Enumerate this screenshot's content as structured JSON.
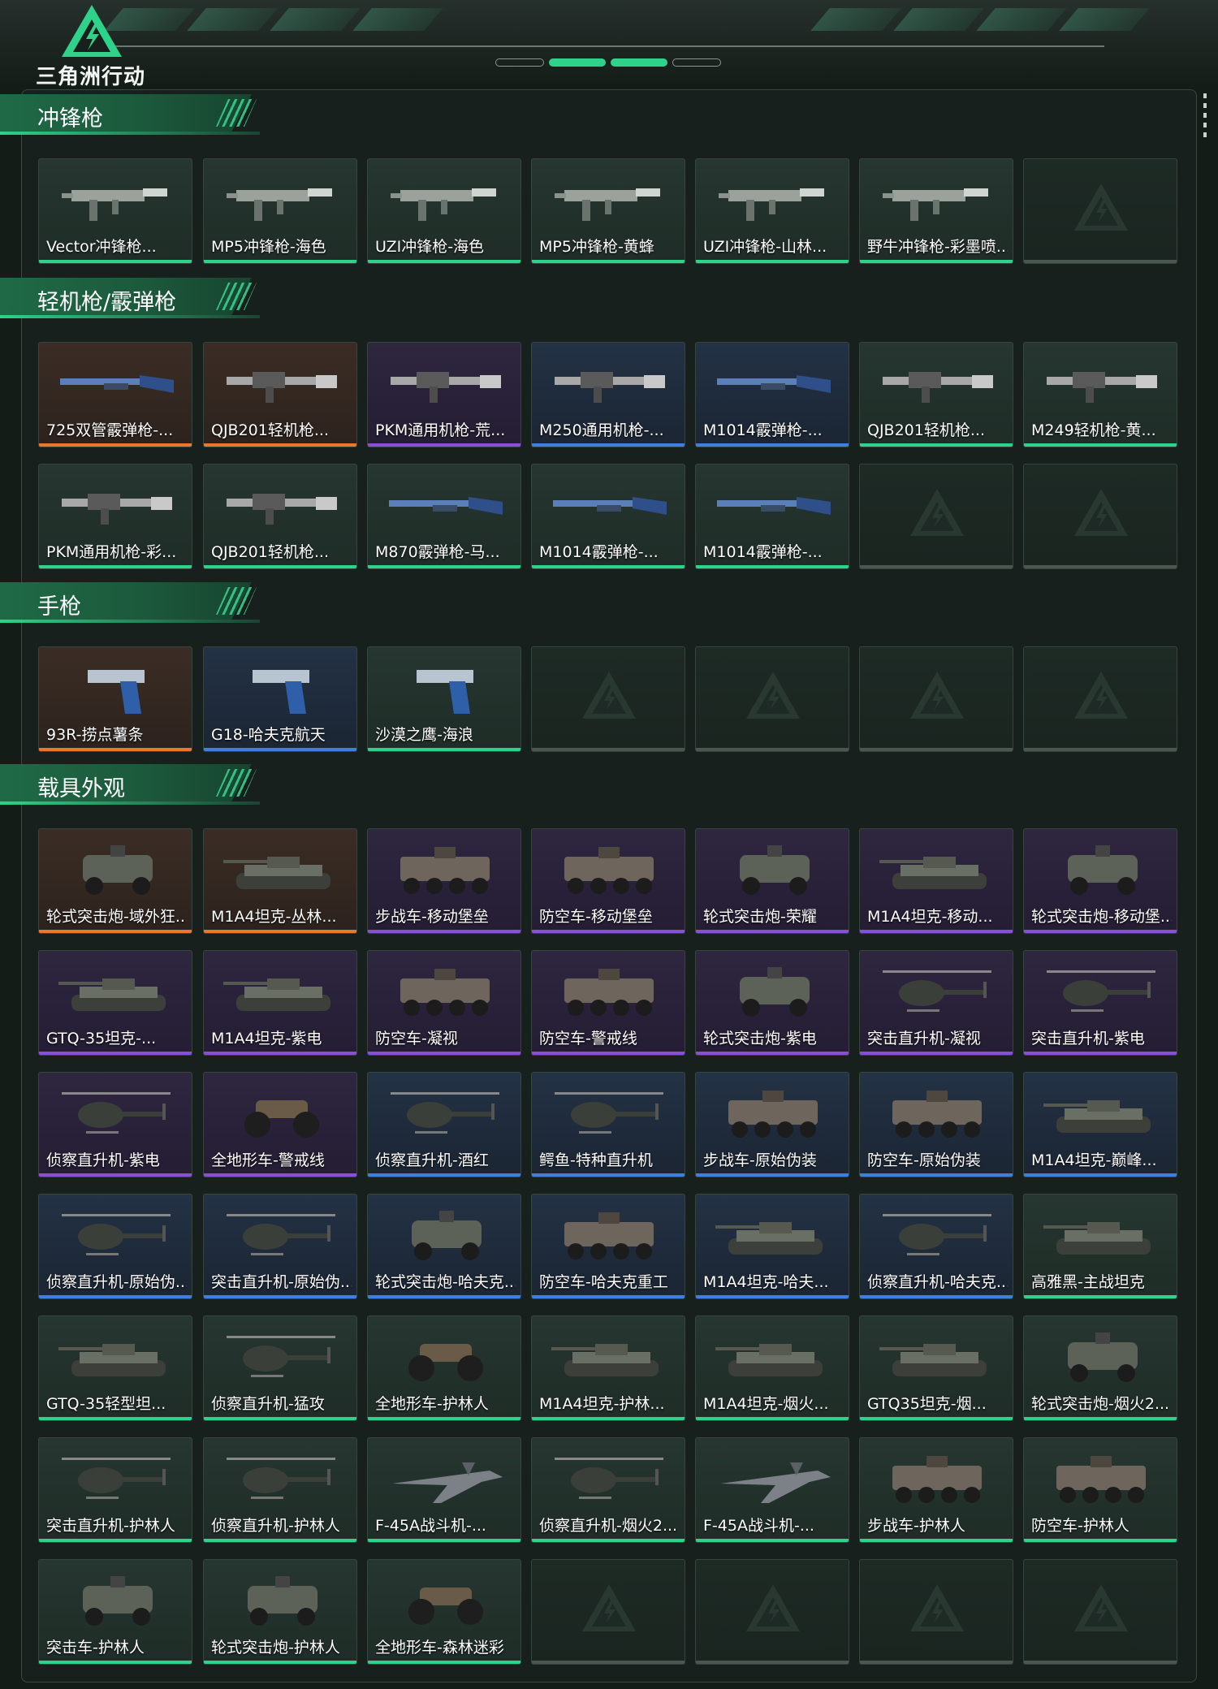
{
  "header": {
    "logo_text": "三角洲行动",
    "colors": {
      "accent": "#2fd28a",
      "panel_border": "#3a4943"
    }
  },
  "rarity_colors": {
    "green": "#2fd28a",
    "blue": "#3f7fe0",
    "purple": "#8a4fd8",
    "orange": "#e6792e",
    "empty": "#4a5650"
  },
  "sections": [
    {
      "title": "冲锋枪",
      "items": [
        {
          "label": "Vector冲锋枪...",
          "rarity": "green",
          "icon": "smg-icon"
        },
        {
          "label": "MP5冲锋枪-海色",
          "rarity": "green",
          "icon": "smg-icon"
        },
        {
          "label": "UZI冲锋枪-海色",
          "rarity": "green",
          "icon": "smg-icon"
        },
        {
          "label": "MP5冲锋枪-黄蜂",
          "rarity": "green",
          "icon": "smg-icon"
        },
        {
          "label": "UZI冲锋枪-山林...",
          "rarity": "green",
          "icon": "smg-icon"
        },
        {
          "label": "野牛冲锋枪-彩墨喷...",
          "rarity": "green",
          "icon": "smg-icon"
        },
        {
          "label": "",
          "rarity": "empty",
          "icon": "placeholder-icon"
        }
      ]
    },
    {
      "title": "轻机枪/霰弹枪",
      "items": [
        {
          "label": "725双管霰弹枪-...",
          "rarity": "orange",
          "icon": "shotgun-icon"
        },
        {
          "label": "QJB201轻机枪...",
          "rarity": "orange",
          "icon": "lmg-icon"
        },
        {
          "label": "PKM通用机枪-荒...",
          "rarity": "purple",
          "icon": "lmg-icon"
        },
        {
          "label": "M250通用机枪-...",
          "rarity": "blue",
          "icon": "lmg-icon"
        },
        {
          "label": "M1014霰弹枪-...",
          "rarity": "blue",
          "icon": "shotgun-icon"
        },
        {
          "label": "QJB201轻机枪...",
          "rarity": "green",
          "icon": "lmg-icon"
        },
        {
          "label": "M249轻机枪-黄...",
          "rarity": "green",
          "icon": "lmg-icon"
        },
        {
          "label": "PKM通用机枪-彩...",
          "rarity": "green",
          "icon": "lmg-icon"
        },
        {
          "label": "QJB201轻机枪...",
          "rarity": "green",
          "icon": "lmg-icon"
        },
        {
          "label": "M870霰弹枪-马...",
          "rarity": "green",
          "icon": "shotgun-icon"
        },
        {
          "label": "M1014霰弹枪-...",
          "rarity": "green",
          "icon": "shotgun-icon"
        },
        {
          "label": "M1014霰弹枪-...",
          "rarity": "green",
          "icon": "shotgun-icon"
        },
        {
          "label": "",
          "rarity": "empty",
          "icon": "placeholder-icon"
        },
        {
          "label": "",
          "rarity": "empty",
          "icon": "placeholder-icon"
        }
      ]
    },
    {
      "title": "手枪",
      "items": [
        {
          "label": "93R-捞点薯条",
          "rarity": "orange",
          "icon": "pistol-icon"
        },
        {
          "label": "G18-哈夫克航天",
          "rarity": "blue",
          "icon": "pistol-icon"
        },
        {
          "label": "沙漠之鹰-海浪",
          "rarity": "green",
          "icon": "pistol-icon"
        },
        {
          "label": "",
          "rarity": "empty",
          "icon": "placeholder-icon"
        },
        {
          "label": "",
          "rarity": "empty",
          "icon": "placeholder-icon"
        },
        {
          "label": "",
          "rarity": "empty",
          "icon": "placeholder-icon"
        },
        {
          "label": "",
          "rarity": "empty",
          "icon": "placeholder-icon"
        }
      ]
    },
    {
      "title": "载具外观",
      "items": [
        {
          "label": "轮式突击炮-域外狂...",
          "rarity": "orange",
          "icon": "armored-car-icon"
        },
        {
          "label": "M1A4坦克-丛林...",
          "rarity": "orange",
          "icon": "tank-icon"
        },
        {
          "label": "步战车-移动堡垒",
          "rarity": "purple",
          "icon": "apc-icon"
        },
        {
          "label": "防空车-移动堡垒",
          "rarity": "purple",
          "icon": "apc-icon"
        },
        {
          "label": "轮式突击炮-荣耀",
          "rarity": "purple",
          "icon": "armored-car-icon"
        },
        {
          "label": "M1A4坦克-移动...",
          "rarity": "purple",
          "icon": "tank-icon"
        },
        {
          "label": "轮式突击炮-移动堡...",
          "rarity": "purple",
          "icon": "armored-car-icon"
        },
        {
          "label": "GTQ-35坦克-...",
          "rarity": "purple",
          "icon": "tank-icon"
        },
        {
          "label": "M1A4坦克-紫电",
          "rarity": "purple",
          "icon": "tank-icon"
        },
        {
          "label": "防空车-凝视",
          "rarity": "purple",
          "icon": "apc-icon"
        },
        {
          "label": "防空车-警戒线",
          "rarity": "purple",
          "icon": "apc-icon"
        },
        {
          "label": "轮式突击炮-紫电",
          "rarity": "purple",
          "icon": "armored-car-icon"
        },
        {
          "label": "突击直升机-凝视",
          "rarity": "purple",
          "icon": "helicopter-icon"
        },
        {
          "label": "突击直升机-紫电",
          "rarity": "purple",
          "icon": "helicopter-icon"
        },
        {
          "label": "侦察直升机-紫电",
          "rarity": "purple",
          "icon": "helicopter-icon"
        },
        {
          "label": "全地形车-警戒线",
          "rarity": "purple",
          "icon": "atv-icon"
        },
        {
          "label": "侦察直升机-酒红",
          "rarity": "blue",
          "icon": "helicopter-icon"
        },
        {
          "label": "鳄鱼-特种直升机",
          "rarity": "blue",
          "icon": "helicopter-icon"
        },
        {
          "label": "步战车-原始伪装",
          "rarity": "blue",
          "icon": "apc-icon"
        },
        {
          "label": "防空车-原始伪装",
          "rarity": "blue",
          "icon": "apc-icon"
        },
        {
          "label": "M1A4坦克-巅峰...",
          "rarity": "blue",
          "icon": "tank-icon"
        },
        {
          "label": "侦察直升机-原始伪...",
          "rarity": "blue",
          "icon": "helicopter-icon"
        },
        {
          "label": "突击直升机-原始伪...",
          "rarity": "blue",
          "icon": "helicopter-icon"
        },
        {
          "label": "轮式突击炮-哈夫克...",
          "rarity": "blue",
          "icon": "armored-car-icon"
        },
        {
          "label": "防空车-哈夫克重工",
          "rarity": "blue",
          "icon": "apc-icon"
        },
        {
          "label": "M1A4坦克-哈夫...",
          "rarity": "blue",
          "icon": "tank-icon"
        },
        {
          "label": "侦察直升机-哈夫克...",
          "rarity": "blue",
          "icon": "helicopter-icon"
        },
        {
          "label": "高雅黑-主战坦克",
          "rarity": "green",
          "icon": "tank-icon"
        },
        {
          "label": "GTQ-35轻型坦...",
          "rarity": "green",
          "icon": "tank-icon"
        },
        {
          "label": "侦察直升机-猛攻",
          "rarity": "green",
          "icon": "helicopter-icon"
        },
        {
          "label": "全地形车-护林人",
          "rarity": "green",
          "icon": "atv-icon"
        },
        {
          "label": "M1A4坦克-护林...",
          "rarity": "green",
          "icon": "tank-icon"
        },
        {
          "label": "M1A4坦克-烟火...",
          "rarity": "green",
          "icon": "tank-icon"
        },
        {
          "label": "GTQ35坦克-烟...",
          "rarity": "green",
          "icon": "tank-icon"
        },
        {
          "label": "轮式突击炮-烟火2...",
          "rarity": "green",
          "icon": "armored-car-icon"
        },
        {
          "label": "突击直升机-护林人",
          "rarity": "green",
          "icon": "helicopter-icon"
        },
        {
          "label": "侦察直升机-护林人",
          "rarity": "green",
          "icon": "helicopter-icon"
        },
        {
          "label": "F-45A战斗机-...",
          "rarity": "green",
          "icon": "jet-icon"
        },
        {
          "label": "侦察直升机-烟火2...",
          "rarity": "green",
          "icon": "helicopter-icon"
        },
        {
          "label": "F-45A战斗机-...",
          "rarity": "green",
          "icon": "jet-icon"
        },
        {
          "label": "步战车-护林人",
          "rarity": "green",
          "icon": "apc-icon"
        },
        {
          "label": "防空车-护林人",
          "rarity": "green",
          "icon": "apc-icon"
        },
        {
          "label": "突击车-护林人",
          "rarity": "green",
          "icon": "armored-car-icon"
        },
        {
          "label": "轮式突击炮-护林人",
          "rarity": "green",
          "icon": "armored-car-icon"
        },
        {
          "label": "全地形车-森林迷彩",
          "rarity": "green",
          "icon": "atv-icon"
        },
        {
          "label": "",
          "rarity": "empty",
          "icon": "placeholder-icon"
        },
        {
          "label": "",
          "rarity": "empty",
          "icon": "placeholder-icon"
        },
        {
          "label": "",
          "rarity": "empty",
          "icon": "placeholder-icon"
        },
        {
          "label": "",
          "rarity": "empty",
          "icon": "placeholder-icon"
        }
      ]
    }
  ]
}
